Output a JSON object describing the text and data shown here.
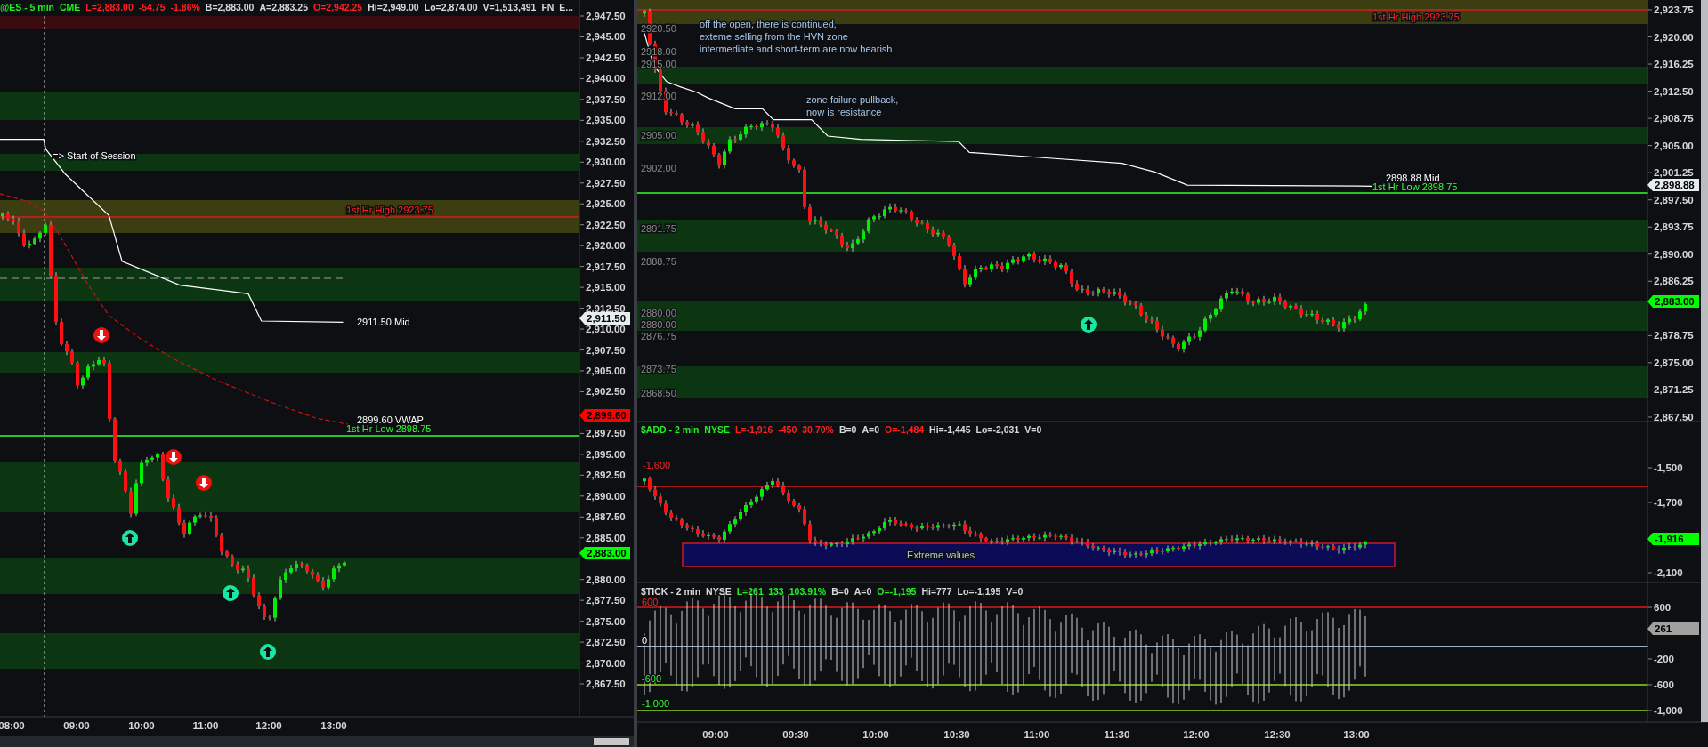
{
  "left_chart": {
    "header": [
      {
        "text": "@ES - 5 min",
        "color": "#22ee22"
      },
      {
        "text": "CME",
        "color": "#22ee22"
      },
      {
        "text": "L=2,883.00",
        "color": "#ff2020"
      },
      {
        "text": "-54.75",
        "color": "#ff2020"
      },
      {
        "text": "-1.86%",
        "color": "#ff2020"
      },
      {
        "text": "B=2,883.00",
        "color": "#d8d8d8"
      },
      {
        "text": "A=2,883.25",
        "color": "#d8d8d8"
      },
      {
        "text": "O=2,942.25",
        "color": "#ff2020"
      },
      {
        "text": "Hi=2,949.00",
        "color": "#d8d8d8"
      },
      {
        "text": "Lo=2,874.00",
        "color": "#d8d8d8"
      },
      {
        "text": "V=1,513,491",
        "color": "#d8d8d8"
      },
      {
        "text": "FN_E...",
        "color": "#d8d8d8"
      }
    ],
    "price_axis": [
      "2,947.50",
      "2,945.00",
      "2,942.50",
      "2,940.00",
      "2,937.50",
      "2,935.00",
      "2,932.50",
      "2,930.00",
      "2,927.50",
      "2,925.00",
      "2,922.50",
      "2,920.00",
      "2,917.50",
      "2,915.00",
      "2,912.50",
      "2,910.00",
      "2,907.50",
      "2,905.00",
      "2,902.50",
      "2,897.50",
      "2,895.00",
      "2,892.50",
      "2,890.00",
      "2,887.50",
      "2,885.00",
      "2,880.00",
      "2,877.50",
      "2,875.00",
      "2,872.50",
      "2,870.00",
      "2,867.50"
    ],
    "price_badges": [
      {
        "text": "2,911.50",
        "color": "#e6eef0"
      },
      {
        "text": "2,899.60",
        "color": "#ff0000"
      },
      {
        "text": "2,883.00",
        "color": "#00ff00"
      }
    ],
    "annotations": [
      {
        "text": "=> Start of Session",
        "kind": "label"
      },
      {
        "text": "1st Hr High 2923.75",
        "kind": "high"
      },
      {
        "text": "2911.50 Mid",
        "kind": "label"
      },
      {
        "text": "2899.60 VWAP",
        "kind": "label"
      },
      {
        "text": "1st Hr Low 2898.75",
        "kind": "low"
      }
    ],
    "signals": [
      {
        "kind": "down"
      },
      {
        "kind": "down"
      },
      {
        "kind": "down"
      },
      {
        "kind": "up"
      },
      {
        "kind": "up"
      },
      {
        "kind": "up"
      }
    ],
    "time_axis": [
      "08:00",
      "09:00",
      "10:00",
      "11:00",
      "12:00",
      "13:00"
    ]
  },
  "right_chart": {
    "price_pane": {
      "price_axis": [
        "2,923.75",
        "2,920.00",
        "2,916.25",
        "2,912.50",
        "2,908.75",
        "2,905.00",
        "2,901.25",
        "2,897.50",
        "2,893.75",
        "2,890.00",
        "2,886.25",
        "2,878.75",
        "2,875.00",
        "2,871.25",
        "2,867.50"
      ],
      "price_badges": [
        {
          "text": "2,898.88",
          "color": "#e6eef0"
        },
        {
          "text": "2,883.00",
          "color": "#00ff00"
        }
      ],
      "level_labels": [
        {
          "text": "2920.50",
          "kind": "gray"
        },
        {
          "text": "2918.00",
          "kind": "gray"
        },
        {
          "text": "2915.00",
          "kind": "gray"
        },
        {
          "text": "2912.00",
          "kind": "gray"
        },
        {
          "text": "2905.00",
          "kind": "gray"
        },
        {
          "text": "2902.00",
          "kind": "gray"
        },
        {
          "text": "2891.75",
          "kind": "gray"
        },
        {
          "text": "2888.75",
          "kind": "gray"
        },
        {
          "text": "2880.00",
          "kind": "gray"
        },
        {
          "text": "2880.00",
          "kind": "gray"
        },
        {
          "text": "2876.75",
          "kind": "gray"
        },
        {
          "text": "2873.75",
          "kind": "gray"
        },
        {
          "text": "2868.50",
          "kind": "gray"
        }
      ],
      "annotations": [
        {
          "text": "1st Hr High 2923.75",
          "kind": "high"
        },
        {
          "text": "off the open, there is continued,\nexteme selling from the HVN zone\nintermediate and short-term are now bearish",
          "kind": "note"
        },
        {
          "text": "zone failure pullback,\nnow is resistance",
          "kind": "note"
        },
        {
          "text": "2898.88 Mid",
          "kind": "label"
        },
        {
          "text": "1st Hr Low 2898.75",
          "kind": "low"
        }
      ],
      "signals": [
        {
          "kind": "up"
        }
      ]
    },
    "add_pane": {
      "header": [
        {
          "text": "$ADD - 2 min",
          "color": "#22ee22"
        },
        {
          "text": "NYSE",
          "color": "#22ee22"
        },
        {
          "text": "L=-1,916",
          "color": "#ff2020"
        },
        {
          "text": "-450",
          "color": "#ff2020"
        },
        {
          "text": "30.70%",
          "color": "#ff2020"
        },
        {
          "text": "B=0",
          "color": "#d8d8d8"
        },
        {
          "text": "A=0",
          "color": "#d8d8d8"
        },
        {
          "text": "O=-1,484",
          "color": "#ff2020"
        },
        {
          "text": "Hi=-1,445",
          "color": "#d8d8d8"
        },
        {
          "text": "Lo=-2,031",
          "color": "#d8d8d8"
        },
        {
          "text": "V=0",
          "color": "#d8d8d8"
        }
      ],
      "price_axis": [
        "-1,500",
        "-1,700",
        "-2,100"
      ],
      "price_badges": [
        {
          "text": "-1,916",
          "color": "#00ff00"
        }
      ],
      "level_labels": [
        {
          "text": "-1,600",
          "kind": "high"
        }
      ],
      "zone_label": "Extreme values"
    },
    "tick_pane": {
      "header": [
        {
          "text": "$TICK - 2 min",
          "color": "#d8d8d8"
        },
        {
          "text": "NYSE",
          "color": "#d8d8d8"
        },
        {
          "text": "L=261",
          "color": "#22ee22"
        },
        {
          "text": "133",
          "color": "#22ee22"
        },
        {
          "text": "103.91%",
          "color": "#22ee22"
        },
        {
          "text": "B=0",
          "color": "#d8d8d8"
        },
        {
          "text": "A=0",
          "color": "#d8d8d8"
        },
        {
          "text": "O=-1,195",
          "color": "#22ee22"
        },
        {
          "text": "Hi=777",
          "color": "#d8d8d8"
        },
        {
          "text": "Lo=-1,195",
          "color": "#d8d8d8"
        },
        {
          "text": "V=0",
          "color": "#d8d8d8"
        }
      ],
      "price_axis": [
        "600",
        "-200",
        "-600",
        "-1,000"
      ],
      "price_badges": [
        {
          "text": "261",
          "color": "#a0a0a0"
        }
      ],
      "level_labels": [
        {
          "text": "600",
          "kind": "high"
        },
        {
          "text": "0",
          "kind": "label"
        },
        {
          "text": "-600",
          "kind": "low"
        },
        {
          "text": "-1,000",
          "kind": "low"
        }
      ]
    },
    "time_axis": [
      "09:00",
      "09:30",
      "10:00",
      "10:30",
      "11:00",
      "11:30",
      "12:00",
      "12:30",
      "13:00"
    ]
  }
}
